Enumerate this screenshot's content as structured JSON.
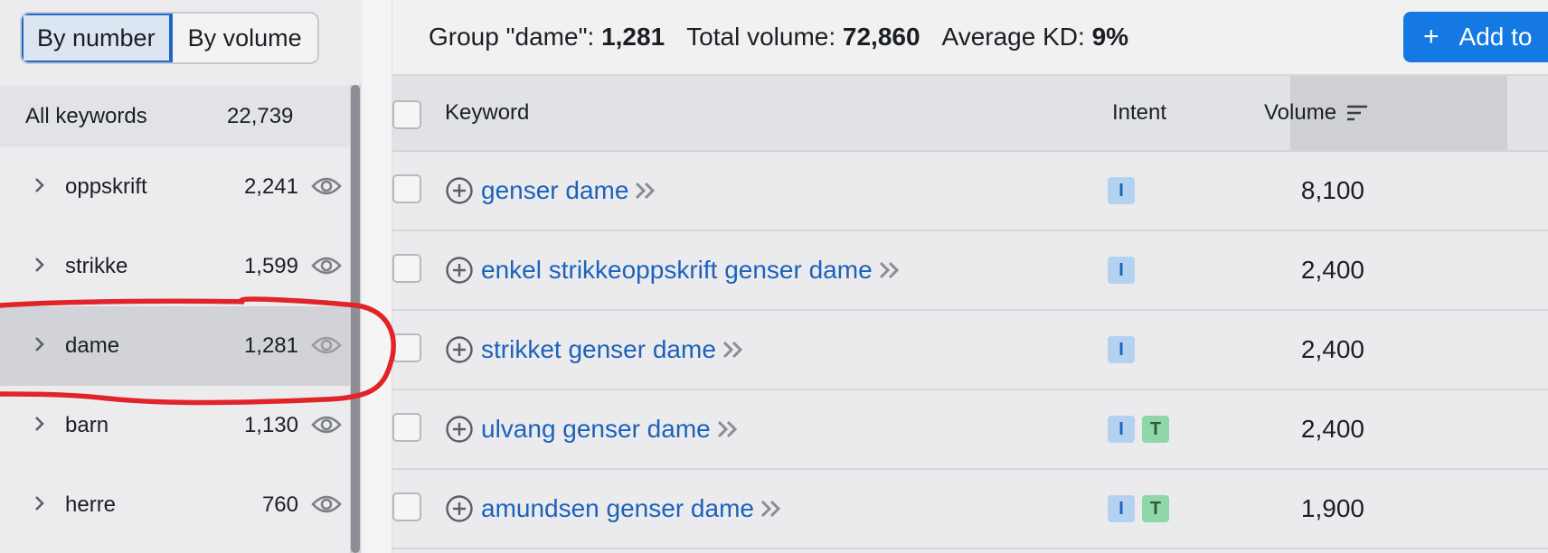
{
  "toggle": {
    "by_number": "By number",
    "by_volume": "By volume"
  },
  "sidebar": {
    "all_label": "All keywords",
    "all_count": "22,739",
    "items": [
      {
        "name": "oppskrift",
        "count": "2,241"
      },
      {
        "name": "strikke",
        "count": "1,599"
      },
      {
        "name": "dame",
        "count": "1,281"
      },
      {
        "name": "barn",
        "count": "1,130"
      },
      {
        "name": "herre",
        "count": "760"
      }
    ]
  },
  "summary": {
    "group_label": "Group \"dame\": ",
    "group_value": "1,281",
    "volume_label": "Total volume: ",
    "volume_value": "72,860",
    "kd_label": "Average KD: ",
    "kd_value": "9%",
    "add_button": "Add to"
  },
  "table": {
    "headers": {
      "keyword": "Keyword",
      "intent": "Intent",
      "volume": "Volume"
    },
    "rows": [
      {
        "keyword": "genser dame",
        "intents": [
          "I"
        ],
        "volume": "8,100"
      },
      {
        "keyword": "enkel strikkeoppskrift genser dame",
        "intents": [
          "I"
        ],
        "volume": "2,400"
      },
      {
        "keyword": "strikket genser dame",
        "intents": [
          "I"
        ],
        "volume": "2,400"
      },
      {
        "keyword": "ulvang genser dame",
        "intents": [
          "I",
          "T"
        ],
        "volume": "2,400"
      },
      {
        "keyword": "amundsen genser dame",
        "intents": [
          "I",
          "T"
        ],
        "volume": "1,900"
      }
    ]
  },
  "colors": {
    "accent": "#1479e2",
    "link": "#1c62bb",
    "annotation": "#e0242a"
  }
}
